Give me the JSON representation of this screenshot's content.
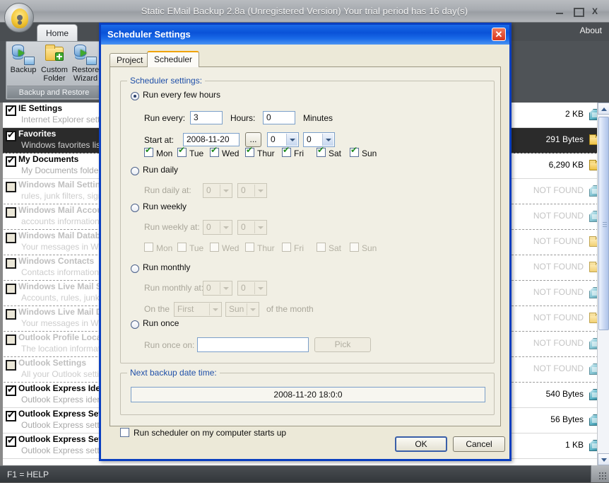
{
  "window": {
    "title": "Static EMail Backup 2.8a (Unregistered Version) Your trial period has 16 day(s)",
    "minimize": "_",
    "maximize": "□",
    "close": "X",
    "about": "About",
    "status": "F1 = HELP"
  },
  "ribbon": {
    "tab_home": "Home",
    "group_label": "Backup and Restore",
    "buttons": [
      {
        "label_line1": "Backup",
        "label_line2": "",
        "icon": "backup-icon"
      },
      {
        "label_line1": "Custom",
        "label_line2": "Folder",
        "icon": "custom-folder-icon"
      },
      {
        "label_line1": "Restore",
        "label_line2": "Wizard",
        "icon": "restore-wizard-icon"
      }
    ]
  },
  "list": {
    "rows": [
      {
        "checked": true,
        "enabled": true,
        "selected": false,
        "title": "IE Settings",
        "subtitle": "Internet Explorer settings",
        "size": "2 KB",
        "icon": "network-file-icon"
      },
      {
        "checked": true,
        "enabled": true,
        "selected": true,
        "title": "Favorites",
        "subtitle": "Windows favorites list",
        "size": "291 Bytes",
        "icon": "folder-icon"
      },
      {
        "checked": true,
        "enabled": true,
        "selected": false,
        "title": "My Documents",
        "subtitle": "My Documents folder",
        "size": "6,290 KB",
        "icon": "folder-icon"
      },
      {
        "checked": false,
        "enabled": false,
        "selected": false,
        "title": "Windows Mail Settings",
        "subtitle": "rules, junk filters, signatures",
        "size": "NOT FOUND",
        "icon": "network-file-icon"
      },
      {
        "checked": false,
        "enabled": false,
        "selected": false,
        "title": "Windows Mail Accounts",
        "subtitle": "accounts information",
        "size": "NOT FOUND",
        "icon": "network-file-icon"
      },
      {
        "checked": false,
        "enabled": false,
        "selected": false,
        "title": "Windows Mail Database",
        "subtitle": "Your messages in Windows Mail",
        "size": "NOT FOUND",
        "icon": "folder-icon"
      },
      {
        "checked": false,
        "enabled": false,
        "selected": false,
        "title": "Windows Contacts",
        "subtitle": "Contacts information",
        "size": "NOT FOUND",
        "icon": "folder-icon"
      },
      {
        "checked": false,
        "enabled": false,
        "selected": false,
        "title": "Windows Live Mail Settings",
        "subtitle": "Accounts, rules, junk filters",
        "size": "NOT FOUND",
        "icon": "network-file-icon"
      },
      {
        "checked": false,
        "enabled": false,
        "selected": false,
        "title": "Windows Live Mail Database",
        "subtitle": "Your messages in Windows Live Mail",
        "size": "NOT FOUND",
        "icon": "folder-icon"
      },
      {
        "checked": false,
        "enabled": false,
        "selected": false,
        "title": "Outlook Profile Location",
        "subtitle": "The location information",
        "size": "NOT FOUND",
        "icon": "network-file-icon"
      },
      {
        "checked": false,
        "enabled": false,
        "selected": false,
        "title": "Outlook Settings",
        "subtitle": "All your Outlook settings",
        "size": "NOT FOUND",
        "icon": "network-file-icon"
      },
      {
        "checked": true,
        "enabled": true,
        "selected": false,
        "title": "Outlook Express Identities",
        "subtitle": "Outlook Express identities",
        "size": "540 Bytes",
        "icon": "network-file-icon"
      },
      {
        "checked": true,
        "enabled": true,
        "selected": false,
        "title": "Outlook Express Settings",
        "subtitle": "Outlook Express settings",
        "size": "56 Bytes",
        "icon": "network-file-icon"
      },
      {
        "checked": true,
        "enabled": true,
        "selected": false,
        "title": "Outlook Express Settings",
        "subtitle": "Outlook Express settings",
        "size": "1 KB",
        "icon": "network-file-icon"
      }
    ]
  },
  "dialog": {
    "title": "Scheduler Settings",
    "close": "✕",
    "tabs": [
      {
        "label": "Project",
        "active": false
      },
      {
        "label": "Scheduler",
        "active": true
      }
    ],
    "settings_group_title": "Scheduler settings:",
    "next_group_title": "Next backup date time:",
    "next_backup_value": "2008-11-20 18:0:0",
    "hours_option": "0",
    "minutes_option": "0",
    "every_hours": {
      "radio_label": "Run every few hours",
      "selected": true,
      "run_every_label": "Run every:",
      "run_every_value": "3",
      "hours_label": "Hours:",
      "hours_value": "0",
      "minutes_label": "Minutes",
      "start_at_label": "Start at:",
      "start_at_value": "2008-11-20",
      "browse_label": "...",
      "hour_select": "0",
      "minute_select": "0",
      "days": [
        {
          "label": "Mon",
          "checked": true
        },
        {
          "label": "Tue",
          "checked": true
        },
        {
          "label": "Wed",
          "checked": true
        },
        {
          "label": "Thur",
          "checked": true
        },
        {
          "label": "Fri",
          "checked": true
        },
        {
          "label": "Sat",
          "checked": true
        },
        {
          "label": "Sun",
          "checked": true
        }
      ]
    },
    "daily": {
      "radio_label": "Run daily",
      "selected": false,
      "at_label": "Run daily at:",
      "hour_select": "0",
      "minute_select": "0"
    },
    "weekly": {
      "radio_label": "Run weekly",
      "selected": false,
      "at_label": "Run weekly at:",
      "hour_select": "0",
      "minute_select": "0",
      "days": [
        {
          "label": "Mon",
          "checked": false
        },
        {
          "label": "Tue",
          "checked": false
        },
        {
          "label": "Wed",
          "checked": false
        },
        {
          "label": "Thur",
          "checked": false
        },
        {
          "label": "Fri",
          "checked": false
        },
        {
          "label": "Sat",
          "checked": false
        },
        {
          "label": "Sun",
          "checked": false
        }
      ]
    },
    "monthly": {
      "radio_label": "Run monthly",
      "selected": false,
      "at_label": "Run monthly at:",
      "hour_select": "0",
      "minute_select": "0",
      "on_the_label": "On the",
      "ordinal_select": "First",
      "weekday_select": "Sun",
      "of_month_label": "of the month"
    },
    "once": {
      "radio_label": "Run once",
      "selected": false,
      "on_label": "Run once on:",
      "value": "",
      "pick_label": "Pick"
    },
    "startup_checkbox": {
      "label": "Run scheduler on my computer starts up",
      "checked": false
    },
    "ok_label": "OK",
    "cancel_label": "Cancel"
  }
}
